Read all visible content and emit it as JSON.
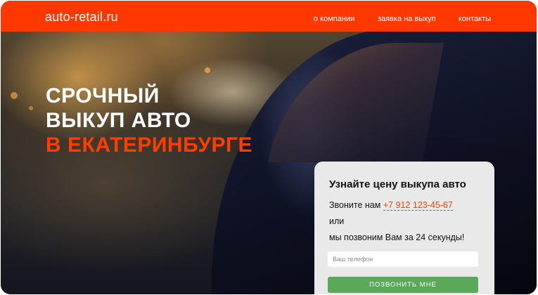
{
  "header": {
    "logo": "auto-retail.ru",
    "nav": [
      {
        "label": "о компании"
      },
      {
        "label": "заявка на выкуп"
      },
      {
        "label": "контакты"
      }
    ],
    "accent_color": "#ff3700"
  },
  "hero": {
    "line1": "СРОЧНЫЙ",
    "line2": "ВЫКУП АВТО",
    "line3": "В ЕКАТЕРИНБУРГЕ"
  },
  "form": {
    "title": "Узнайте цену выкупа авто",
    "call_prefix": "Звоните нам",
    "phone": "+7 912 123-45-67",
    "or": "или",
    "callback_text": "мы позвоним Вам за 24 секунды!",
    "input_placeholder": "Ваш телефон",
    "submit_label": "ПОЗВОНИТЬ МНЕ",
    "button_color": "#5aa85a"
  }
}
